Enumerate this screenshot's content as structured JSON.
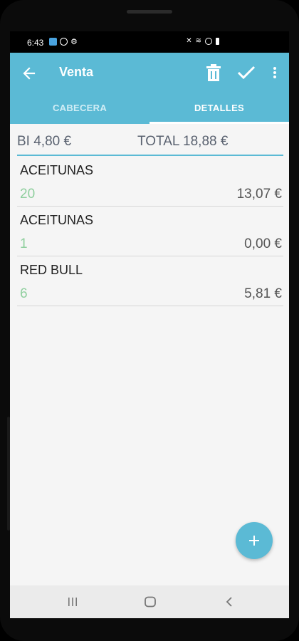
{
  "status": {
    "time": "6:43"
  },
  "appbar": {
    "title": "Venta",
    "tabs": [
      "CABECERA",
      "DETALLES"
    ],
    "active_tab": "DETALLES"
  },
  "summary": {
    "bi": "BI 4,80 €",
    "total": "TOTAL 18,88 €"
  },
  "lines": [
    {
      "name": "ACEITUNAS",
      "qty": "20",
      "amount": "13,07 €"
    },
    {
      "name": "ACEITUNAS",
      "qty": "1",
      "amount": "0,00 €"
    },
    {
      "name": "RED BULL",
      "qty": "6",
      "amount": "5,81 €"
    }
  ],
  "fab": {
    "icon": "plus-icon"
  },
  "colors": {
    "accent": "#5bbad5",
    "qty": "#8fcf9e"
  }
}
